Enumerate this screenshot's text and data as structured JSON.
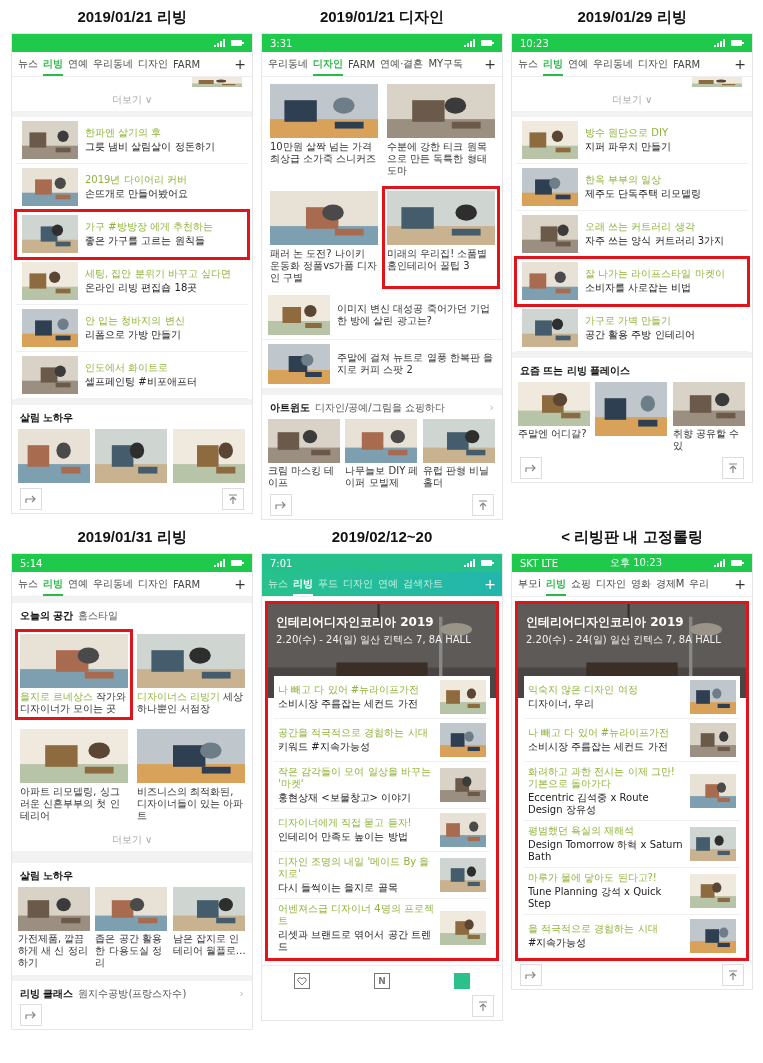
{
  "panels": [
    {
      "title": "2019/01/21 리빙",
      "status": {
        "color": "#1ec94c"
      },
      "tabs": [
        {
          "label": "뉴스",
          "selected": false
        },
        {
          "label": "리빙",
          "selected": true
        },
        {
          "label": "연예",
          "selected": false
        },
        {
          "label": "우리동네",
          "selected": false
        },
        {
          "label": "디자인",
          "selected": false
        },
        {
          "label": "FARM",
          "selected": false
        }
      ],
      "add_tab": "+",
      "blocks": [
        {
          "kind": "strip"
        },
        {
          "kind": "more",
          "label": "더보기 ∨"
        },
        {
          "kind": "list",
          "items": [
            {
              "headline": "한파엔 살기의 후",
              "subtitle": "그릇 냄비 살림살이 정돈하기",
              "highlighted": false
            },
            {
              "headline": "2019년 다이어리 커버",
              "subtitle": "손뜨개로 만들어봤어요",
              "highlighted": false
            },
            {
              "headline": "가구 #방방장 에게 추천하는",
              "subtitle": "좋은 가구를 고르는 원칙들",
              "highlighted": true
            },
            {
              "headline": "세팅, 집안 분위기 바꾸고 싶다면",
              "subtitle": "온라인 리빙 편집숍 18곳",
              "highlighted": false
            },
            {
              "headline": "안 입는 청바지의 변신",
              "subtitle": "리폼으로 가방 만들기",
              "highlighted": false
            },
            {
              "headline": "인도에서 화이트로",
              "subtitle": "셀프페인팅 #비포애프터",
              "highlighted": false
            }
          ]
        },
        {
          "kind": "section",
          "title": "살림 노하우"
        },
        {
          "kind": "carousel",
          "items": [
            {
              "kind": "picture"
            },
            {
              "kind": "picture"
            },
            {
              "kind": "picture"
            }
          ]
        }
      ],
      "floating": {
        "share": true,
        "top": true
      }
    },
    {
      "title": "2019/01/21 디자인",
      "status": {
        "color": "#1ec94c",
        "time": "3:31"
      },
      "tabs": [
        {
          "label": "우리동네",
          "selected": false
        },
        {
          "label": "디자인",
          "selected": true
        },
        {
          "label": "FARM",
          "selected": false
        },
        {
          "label": "연예·결혼",
          "selected": false
        },
        {
          "label": "MY구독",
          "selected": false
        }
      ],
      "add_tab": "+",
      "blocks": [
        {
          "kind": "grid",
          "items": [
            {
              "text": "10만원 살짝 넘는 가격 최상급 소가죽 스니커즈",
              "highlighted": false
            },
            {
              "text": "수분에 강한 티크 원목으로 만든 독특한 형태 도마",
              "highlighted": false
            }
          ]
        },
        {
          "kind": "grid",
          "items": [
            {
              "text": "패러 논 도전? 나이키 운동화 정품vs가품 디자인 구별",
              "highlighted": false
            },
            {
              "text": "미래의 우리집! 소품별 홈인테리어 꿀팁 3",
              "highlighted": true
            }
          ]
        },
        {
          "kind": "stories",
          "items": [
            {
              "text": "이미지 변신 대성공 죽어가던 기업 한 방에 살린 광고는?"
            },
            {
              "text": "주말에 걸쳐 뉴트로 열풍 한복판 을지로 커피 스팟 2"
            }
          ]
        },
        {
          "kind": "section",
          "title": "아트윈도",
          "subtitle": "디자인/공예/그림을 쇼핑하다",
          "arrow": "›"
        },
        {
          "kind": "carousel",
          "items": [
            {
              "caption": "크림 마스킹 테이프"
            },
            {
              "caption": "나무늘보 DIY 페이퍼 모빌제"
            },
            {
              "caption": "유럽 판형 비닐 홀더"
            }
          ]
        }
      ],
      "floating": {
        "share": true,
        "top": true
      }
    },
    {
      "title": "2019/01/29 리빙",
      "status": {
        "color": "#1ec94c",
        "time": "10:23"
      },
      "tabs": [
        {
          "label": "뉴스",
          "selected": false
        },
        {
          "label": "리빙",
          "selected": true
        },
        {
          "label": "연예",
          "selected": false
        },
        {
          "label": "우리동네",
          "selected": false
        },
        {
          "label": "디자인",
          "selected": false
        },
        {
          "label": "FARM",
          "selected": false
        }
      ],
      "add_tab": "+",
      "blocks": [
        {
          "kind": "strip"
        },
        {
          "kind": "more",
          "label": "더보기 ∨"
        },
        {
          "kind": "list",
          "items": [
            {
              "headline": "방수 원단으로 DIY",
              "subtitle": "지퍼 파우치 만들기",
              "highlighted": false
            },
            {
              "headline": "한옥 부부의 일상",
              "subtitle": "제주도 단독주택 리모델링",
              "highlighted": false
            },
            {
              "headline": "오래 쓰는 커트러리 생각",
              "subtitle": "자주 쓰는 양식 커트러리 3가지",
              "highlighted": false
            },
            {
              "headline": "잘 나가는 라이프스타일 마켓이",
              "subtitle": "소비자를 사로잡는 비법",
              "highlighted": true
            },
            {
              "headline": "가구로 가벽 만들기",
              "subtitle": "공간 활용 주방 인테리어",
              "highlighted": false
            }
          ]
        },
        {
          "kind": "section",
          "title": "요즘 뜨는 리빙 플레이스"
        },
        {
          "kind": "carousel",
          "items": [
            {
              "caption": "주말엔 어디갈?"
            },
            {
              "kind": "picture"
            },
            {
              "caption": "취향 공유할 수 있"
            }
          ]
        }
      ],
      "floating": {
        "share": true,
        "top": true
      }
    },
    {
      "title": "2019/01/31 리빙",
      "status": {
        "color": "#1ec94c",
        "time": "5:14"
      },
      "tabs": [
        {
          "label": "뉴스",
          "selected": false
        },
        {
          "label": "리빙",
          "selected": true
        },
        {
          "label": "연예",
          "selected": false
        },
        {
          "label": "우리동네",
          "selected": false
        },
        {
          "label": "디자인",
          "selected": false
        },
        {
          "label": "FARM",
          "selected": false
        }
      ],
      "add_tab": "+",
      "blocks": [
        {
          "kind": "section",
          "title": "오늘의 공간",
          "subtitle": "홈스타일"
        },
        {
          "kind": "grid",
          "items": [
            {
              "accent": "을지로 르네상스",
              "text": "작가와 디자이너가 모이는 곳",
              "highlighted": true
            },
            {
              "accent": "디자이너스 리빙기",
              "text": "세상 하나뿐인 서점장",
              "highlighted": false
            }
          ]
        },
        {
          "kind": "grid",
          "items": [
            {
              "text": "아파트 리모델링, 싱그러운 신혼부부의 첫 인테리어",
              "highlighted": false
            },
            {
              "text": "비즈니스의 최적화된, 디자이너들이 있는 아파트",
              "highlighted": false
            }
          ]
        },
        {
          "kind": "more",
          "label": "더보기 ∨"
        },
        {
          "kind": "section",
          "title": "살림 노하우"
        },
        {
          "kind": "carousel",
          "items": [
            {
              "caption": "가전제품, 깔끔하게 새 신 정리하기"
            },
            {
              "caption": "좁은 공간 활용한 다용도실 정리"
            },
            {
              "caption": "남은 잡지로 인테리어 월플로…"
            }
          ]
        },
        {
          "kind": "section",
          "title": "리빙 클래스",
          "subtitle": "원지수공방(프랑스자수)",
          "arrow": "›"
        }
      ],
      "floating": {
        "share": true,
        "top": false
      }
    },
    {
      "title": "2019/02/12~20",
      "status": {
        "color": "#26c08c",
        "time": "7:01"
      },
      "tabs": [
        {
          "label": "뉴스",
          "selected": false
        },
        {
          "label": "리빙",
          "selected": true
        },
        {
          "label": "푸드",
          "selected": false
        },
        {
          "label": "디자인",
          "selected": false
        },
        {
          "label": "연예",
          "selected": false
        },
        {
          "label": "검색차트",
          "selected": false
        }
      ],
      "add_tab": "+",
      "blocks": [
        {
          "kind": "feature",
          "title": "인테리어디자인코리아 2019",
          "subtitle": "2.20(수) - 24(일) 일산 킨텍스 7, 8A HALL",
          "highlighted": true,
          "items": [
            {
              "headline": "나 빼고 다 있어 #뉴라이프가전",
              "subtitle": "소비시장 주름잡는 세컨드 가전"
            },
            {
              "headline": "공간을 적극적으로 경험하는 시대",
              "subtitle": "키워드 #지속가능성"
            },
            {
              "headline": "작은 감각들이 모여 일상을 바꾸는 '마켓'",
              "subtitle": "홍현상재 <보물창고> 이야기"
            },
            {
              "headline": "디자이너에게 직접 묻고 듣자!",
              "subtitle": "인테리어 만족도 높이는 방법"
            },
            {
              "headline": "디자인 조명의 내일 '메이드 By 을지로'",
              "subtitle": "다시 들썩이는 을지로 골목"
            },
            {
              "headline": "어벤져스급 디자이너 4명의 프로젝트",
              "subtitle": "리셋과 브랜드로 엮어서 공간 트렌드"
            }
          ]
        }
      ],
      "floating": {
        "share": false,
        "top": true
      },
      "bottom_nav": [
        {
          "kind": "heart",
          "selected": false
        },
        {
          "kind": "home",
          "glyph": "N",
          "selected": false
        },
        {
          "kind": "grid",
          "selected": true
        }
      ]
    },
    {
      "title": "< 리빙판 내 고정롤링",
      "status": {
        "color": "#1ec94c",
        "carrier": "SKT LTE",
        "time": "오후 10:23"
      },
      "tabs": [
        {
          "label": "부모i",
          "selected": false
        },
        {
          "label": "리빙",
          "selected": true
        },
        {
          "label": "쇼핑",
          "selected": false
        },
        {
          "label": "디자인",
          "selected": false
        },
        {
          "label": "영화",
          "selected": false
        },
        {
          "label": "경제M",
          "selected": false
        },
        {
          "label": "우리",
          "selected": false
        }
      ],
      "add_tab": "+",
      "blocks": [
        {
          "kind": "feature",
          "title": "인테리어디자인코리아 2019",
          "subtitle": "2.20(수) - 24(일) 일산 킨텍스 7, 8A HALL",
          "highlighted": true,
          "items": [
            {
              "headline": "익숙지 않은 디자인 여정",
              "subtitle": "디자이너, 우리"
            },
            {
              "headline": "나 빼고 다 있어 #뉴라이프가전",
              "subtitle": "소비시장 주름잡는 세컨드 가전"
            },
            {
              "headline": "화려하고 과한 전시는 이제 그만! 기본으로 돌아가다",
              "subtitle": "Eccentric 김석중 x Route Design 장유성"
            },
            {
              "headline": "평범했던 욕실의 재해석",
              "subtitle": "Design Tomorrow 하혁 x Saturn Bath"
            },
            {
              "headline": "마루가 물에 닿아도 된다고?!",
              "subtitle": "Tune Planning 강석 x Quick Step"
            },
            {
              "headline": "을 적극적으로 경험하는 시대",
              "subtitle": "#지속가능성"
            }
          ]
        }
      ],
      "floating": {
        "share": true,
        "top": true
      }
    }
  ]
}
